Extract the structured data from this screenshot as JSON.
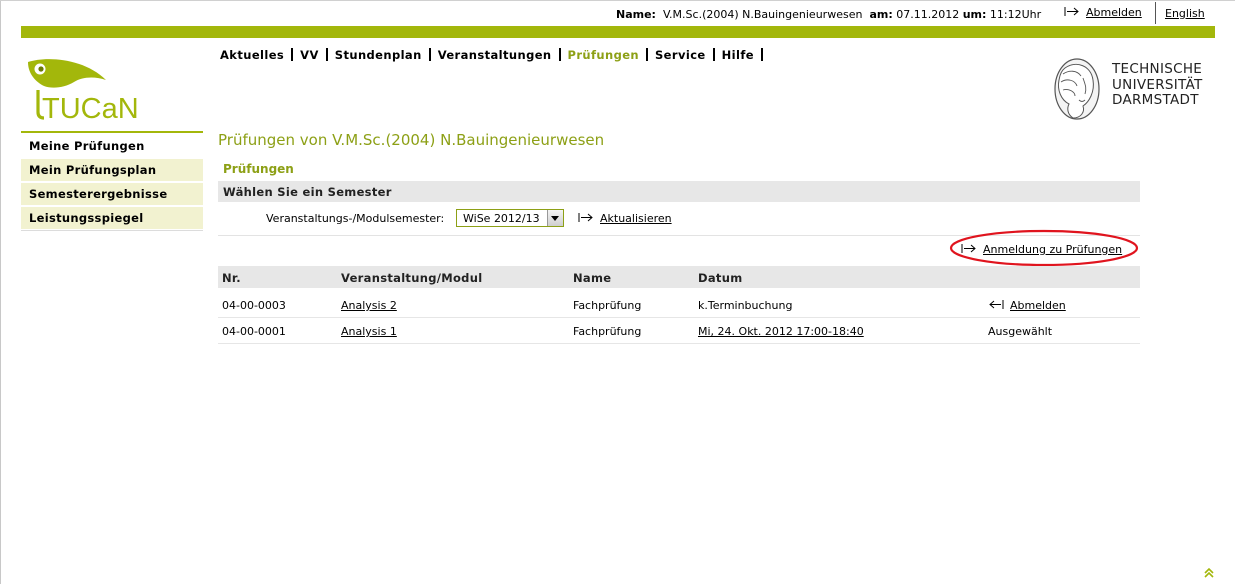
{
  "topbar": {
    "name_label": "Name:",
    "name_value": "V.M.Sc.(2004) N.Bauingenieurwesen",
    "date_label": "am:",
    "date_value": "07.11.2012",
    "time_label": "um:",
    "time_value": "11:12Uhr",
    "logout": "Abmelden",
    "language": "English"
  },
  "main_nav": [
    "Aktuelles",
    "VV",
    "Stundenplan",
    "Veranstaltungen",
    "Prüfungen",
    "Service",
    "Hilfe"
  ],
  "main_nav_active": "Prüfungen",
  "logo": {
    "tucan": "TUCaN",
    "tu_lines": [
      "TECHNISCHE",
      "UNIVERSITÄT",
      "DARMSTADT"
    ]
  },
  "sidebar": {
    "items": [
      "Meine Prüfungen",
      "Mein Prüfungsplan",
      "Semesterergebnisse",
      "Leistungsspiegel"
    ],
    "active": "Meine Prüfungen"
  },
  "page": {
    "title": "Prüfungen von V.M.Sc.(2004) N.Bauingenieurwesen",
    "section": "Prüfungen",
    "choose_semester": "Wählen Sie ein Semester",
    "semester_label": "Veranstaltungs-/Modulsemester:",
    "semester_value": "WiSe 2012/13",
    "refresh": "Aktualisieren",
    "register_link": "Anmeldung zu Prüfungen"
  },
  "table": {
    "headers": [
      "Nr.",
      "Veranstaltung/Modul",
      "Name",
      "Datum"
    ],
    "rows": [
      {
        "nr": "04-00-0003",
        "module": "Analysis 2",
        "name": "Fachprüfung",
        "date": "k.Terminbuchung",
        "status": "Abmelden"
      },
      {
        "nr": "04-00-0001",
        "module": "Analysis 1",
        "name": "Fachprüfung",
        "date": "Mi, 24. Okt. 2012 17:00-18:40",
        "status": "Ausgewählt"
      }
    ]
  },
  "colors": {
    "accent": "#a3b70b",
    "accent_text": "#8da016",
    "highlight": "#e0141e"
  }
}
